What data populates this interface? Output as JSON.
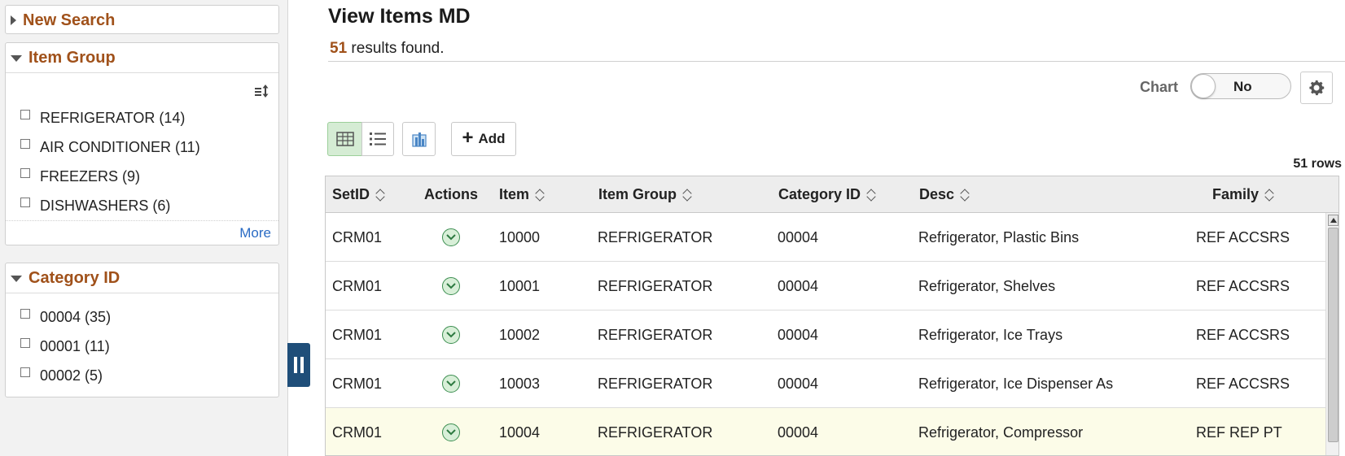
{
  "left_panel": {
    "new_search": {
      "label": "New Search"
    },
    "item_group": {
      "label": "Item Group",
      "items": [
        {
          "label": "REFRIGERATOR (14)"
        },
        {
          "label": "AIR CONDITIONER (11)"
        },
        {
          "label": "FREEZERS (9)"
        },
        {
          "label": "DISHWASHERS (6)"
        }
      ],
      "more_label": "More"
    },
    "category_id": {
      "label": "Category ID",
      "items": [
        {
          "label": "00004 (35)"
        },
        {
          "label": "00001 (11)"
        },
        {
          "label": "00002 (5)"
        }
      ]
    }
  },
  "main": {
    "title": "View Items MD",
    "results_count": "51",
    "results_suffix": " results found.",
    "chart_label": "Chart",
    "chart_toggle_value": "No",
    "add_label": "Add",
    "rows_count": "51 rows"
  },
  "grid": {
    "columns": [
      "SetID",
      "Actions",
      "Item",
      "Item Group",
      "Category ID",
      "Desc",
      "Family"
    ],
    "rows": [
      {
        "setid": "CRM01",
        "item": "10000",
        "item_group": "REFRIGERATOR",
        "category_id": "00004",
        "desc": "Refrigerator, Plastic Bins",
        "family": "REF ACCSRS"
      },
      {
        "setid": "CRM01",
        "item": "10001",
        "item_group": "REFRIGERATOR",
        "category_id": "00004",
        "desc": "Refrigerator, Shelves",
        "family": "REF ACCSRS"
      },
      {
        "setid": "CRM01",
        "item": "10002",
        "item_group": "REFRIGERATOR",
        "category_id": "00004",
        "desc": "Refrigerator, Ice Trays",
        "family": "REF ACCSRS"
      },
      {
        "setid": "CRM01",
        "item": "10003",
        "item_group": "REFRIGERATOR",
        "category_id": "00004",
        "desc": "Refrigerator, Ice Dispenser As",
        "family": "REF ACCSRS"
      },
      {
        "setid": "CRM01",
        "item": "10004",
        "item_group": "REFRIGERATOR",
        "category_id": "00004",
        "desc": "Refrigerator, Compressor",
        "family": "REF REP PT"
      }
    ]
  },
  "colors": {
    "facet_header": "#a0511a",
    "link": "#2a6bc4",
    "collapse_handle": "#1f4e79",
    "grid_view_active": "#d5ecd4",
    "highlight_row": "#fcfce8"
  },
  "icons": {
    "sort": "sort-icon",
    "settings": "gear-icon",
    "grid_view": "grid-view-icon",
    "list_view": "list-view-icon",
    "pivot": "pivot-chart-icon",
    "action": "chevron-down-circle-icon"
  }
}
